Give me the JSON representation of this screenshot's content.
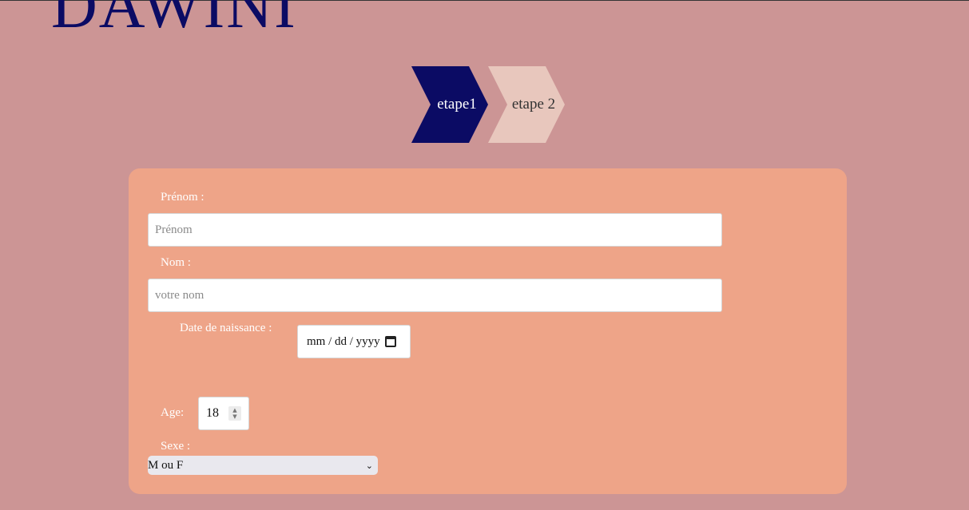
{
  "header": {
    "logo_text": "DAWINI"
  },
  "steps": [
    {
      "label": "etape1",
      "active": true
    },
    {
      "label": "etape 2",
      "active": false
    }
  ],
  "form": {
    "prenom": {
      "label": "Prénom :",
      "placeholder": "Prénom",
      "value": ""
    },
    "nom": {
      "label": "Nom :",
      "placeholder": "votre nom",
      "value": ""
    },
    "date_naissance": {
      "label": "Date de naissance :",
      "display": "mm / dd / yyyy"
    },
    "age": {
      "label": "Age:",
      "value": "18"
    },
    "sexe": {
      "label": "Sexe :",
      "selected": "M ou F"
    }
  },
  "colors": {
    "page_bg": "#cc9595",
    "brand": "#0b0b64",
    "card_bg": "#eea488",
    "step_inactive": "#e8c7bd"
  },
  "icons": [
    "calendar-icon",
    "spinner-icon",
    "chevron-down-icon"
  ]
}
